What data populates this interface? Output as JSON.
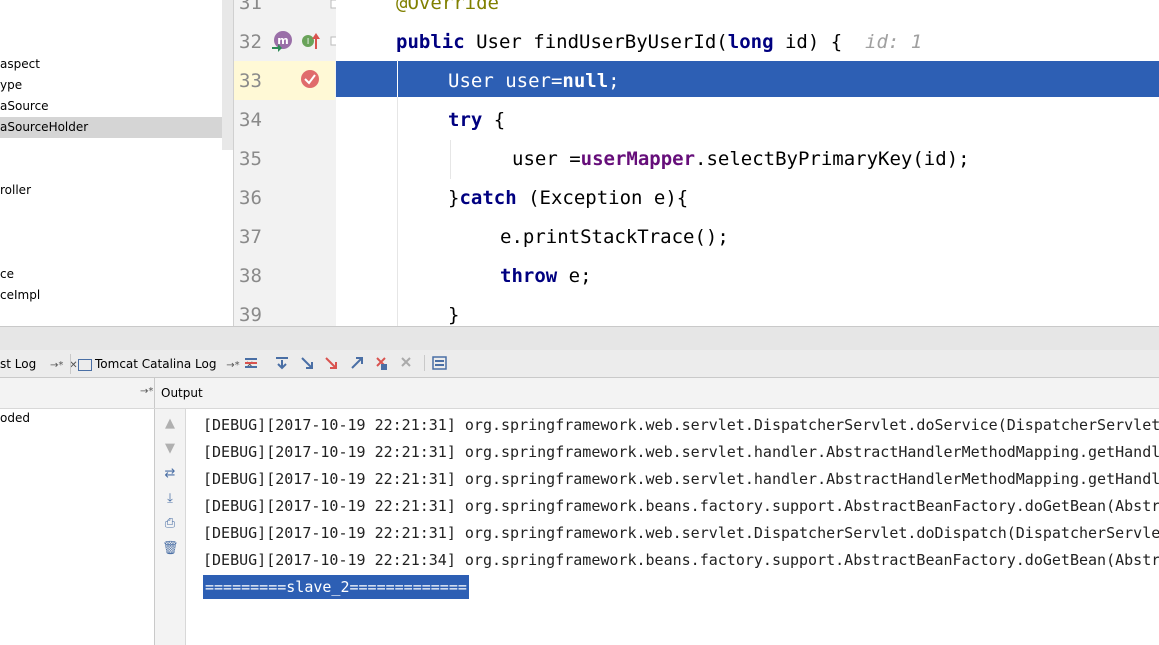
{
  "project_tree": {
    "items": [
      {
        "label": "aspect",
        "selected": false
      },
      {
        "label": "ype",
        "selected": false
      },
      {
        "label": "aSource",
        "selected": false
      },
      {
        "label": "aSourceHolder",
        "selected": true
      },
      {
        "label": "roller",
        "selected": false
      },
      {
        "label": "ce",
        "selected": false
      },
      {
        "label": "ceImpl",
        "selected": false
      }
    ]
  },
  "editor": {
    "line_numbers": [
      "31",
      "32",
      "33",
      "34",
      "35",
      "36",
      "37",
      "38",
      "39"
    ],
    "lines": {
      "l31": {
        "ann": "@Override"
      },
      "l32": {
        "kw1": "public",
        "t1": " User findUserByUserId(",
        "kw2": "long",
        "t2": " id) {",
        "hint": "  id: 1"
      },
      "l33": {
        "t1": "User user=",
        "kw": "null",
        "t2": ";"
      },
      "l34": {
        "kw": "try",
        "t": " {"
      },
      "l35": {
        "t1": "user =",
        "fld": "userMapper",
        "t2": ".selectByPrimaryKey(id);"
      },
      "l36": {
        "t1": "}",
        "kw": "catch",
        "t2": " (Exception e){"
      },
      "l37": {
        "t": "e.printStackTrace();"
      },
      "l38": {
        "kw": "throw",
        "t": " e;"
      },
      "l39": {
        "t": "}"
      }
    }
  },
  "tabs": {
    "tab1": {
      "label": "st Log",
      "pin": "→*",
      "close": "✕"
    },
    "tab2": {
      "label": "Tomcat Catalina Log",
      "pin": "→*",
      "close": "✕"
    }
  },
  "output": {
    "title": "Output",
    "pin": "→*",
    "left_item": "oded",
    "logs": [
      "[DEBUG][2017-10-19 22:21:31] org.springframework.web.servlet.DispatcherServlet.doService(DispatcherServlet.",
      "[DEBUG][2017-10-19 22:21:31] org.springframework.web.servlet.handler.AbstractHandlerMethodMapping.getHandle",
      "[DEBUG][2017-10-19 22:21:31] org.springframework.web.servlet.handler.AbstractHandlerMethodMapping.getHandle",
      "[DEBUG][2017-10-19 22:21:31] org.springframework.beans.factory.support.AbstractBeanFactory.doGetBean(Abstra",
      "[DEBUG][2017-10-19 22:21:31] org.springframework.web.servlet.DispatcherServlet.doDispatch(DispatcherServlet",
      "[DEBUG][2017-10-19 22:21:34] org.springframework.beans.factory.support.AbstractBeanFactory.doGetBean(Abstra"
    ],
    "selected_line": "=========slave_2============="
  },
  "colors": {
    "execution_line": "#2d5fb4",
    "keyword": "#000080",
    "field": "#660e7a",
    "annotation": "#808000"
  }
}
